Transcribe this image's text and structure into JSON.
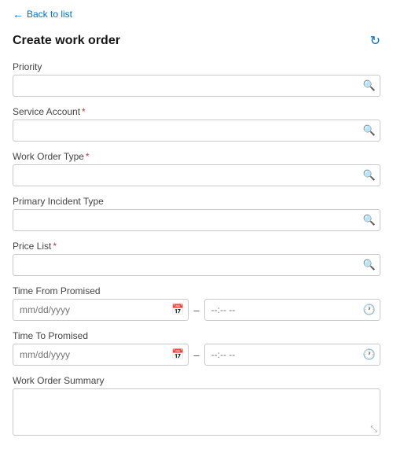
{
  "back_link": {
    "text": "Back to list",
    "arrow": "←"
  },
  "header": {
    "title": "Create work order",
    "refresh_icon": "↻"
  },
  "fields": {
    "priority": {
      "label": "Priority",
      "placeholder": "",
      "required": false
    },
    "service_account": {
      "label": "Service Account",
      "placeholder": "",
      "required": true
    },
    "work_order_type": {
      "label": "Work Order Type",
      "placeholder": "",
      "required": true
    },
    "primary_incident_type": {
      "label": "Primary Incident Type",
      "placeholder": "",
      "required": false
    },
    "price_list": {
      "label": "Price List",
      "placeholder": "",
      "required": true
    },
    "time_from_promised": {
      "label": "Time From Promised",
      "date_placeholder": "mm/dd/yyyy",
      "time_placeholder": "--:-- --"
    },
    "time_to_promised": {
      "label": "Time To Promised",
      "date_placeholder": "mm/dd/yyyy",
      "time_placeholder": "--:-- --"
    },
    "work_order_summary": {
      "label": "Work Order Summary",
      "placeholder": ""
    }
  }
}
